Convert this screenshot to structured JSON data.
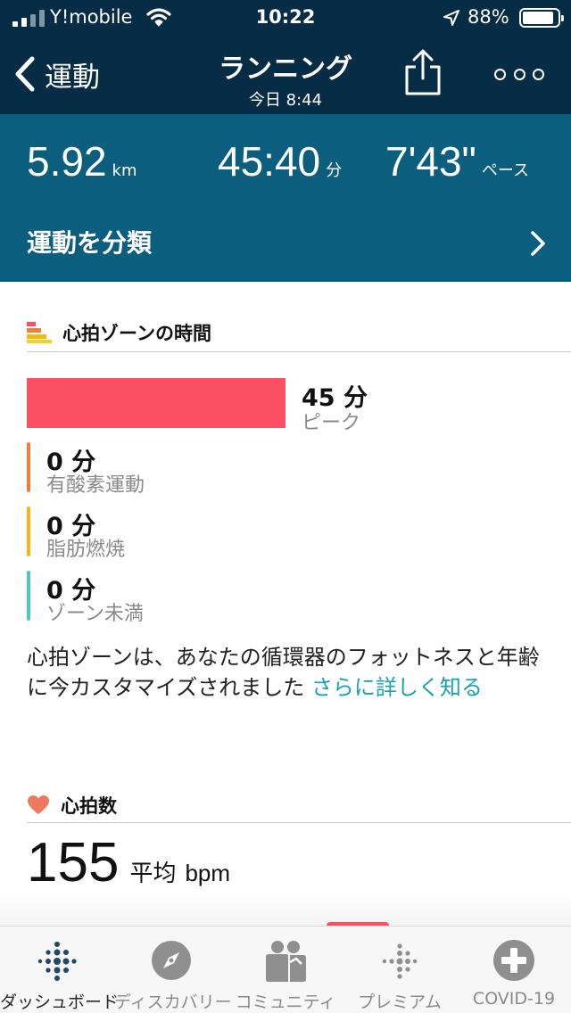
{
  "status_bar": {
    "carrier": "Y!mobile",
    "time": "10:22",
    "battery": "88%"
  },
  "header": {
    "back_label": "運動",
    "title": "ランニング",
    "subtitle": "今日 8:44"
  },
  "stats": {
    "distance": {
      "value": "5.92",
      "unit": "km"
    },
    "duration": {
      "value": "45:40",
      "unit": "分"
    },
    "pace": {
      "value": "7'43\"",
      "unit": "ペース"
    },
    "classify_label": "運動を分類"
  },
  "zones": {
    "heading": "心拍ゾーンの時間",
    "peak": {
      "value": "45 分",
      "label": "ピーク",
      "color": "#fb4f63"
    },
    "items": [
      {
        "value": "0 分",
        "label": "有酸素運動",
        "color": "#f07f3c"
      },
      {
        "value": "0 分",
        "label": "脂肪燃焼",
        "color": "#f5b617"
      },
      {
        "value": "0 分",
        "label": "ゾーン未満",
        "color": "#4ec7c9"
      }
    ],
    "description": "心拍ゾーンは、あなたの循環器のフォットネスと年齢に今カスタマイズされました",
    "link": "さらに詳しく知る"
  },
  "heart_rate": {
    "heading": "心拍数",
    "value": "155",
    "avg_label": "平均",
    "unit": "bpm"
  },
  "tabbar": {
    "tabs": [
      {
        "label": "ダッシュボード",
        "icon": "fitbit-dots-icon"
      },
      {
        "label": "ディスカバリー",
        "icon": "compass-icon"
      },
      {
        "label": "コミュニティ",
        "icon": "people-icon"
      },
      {
        "label": "プレミアム",
        "icon": "premium-dots-icon"
      },
      {
        "label": "COVID-19",
        "icon": "plus-circle-icon"
      }
    ]
  },
  "colors": {
    "header_bg": "#062c46",
    "stats_bg": "#0b5e7e",
    "link": "#1aa0b2",
    "heart": "#f0785d"
  }
}
